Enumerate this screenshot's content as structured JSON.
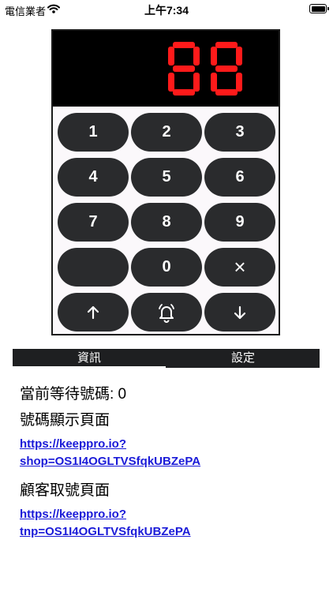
{
  "status_bar": {
    "carrier": "電信業者",
    "time": "上午7:34"
  },
  "display": {
    "number": "88",
    "digit_color": "#ff1a1a"
  },
  "keypad": {
    "keys": [
      "1",
      "2",
      "3",
      "4",
      "5",
      "6",
      "7",
      "8",
      "9",
      "",
      "0",
      "×"
    ],
    "nav": {
      "up_icon": "arrow-up-icon",
      "bell_icon": "bell-icon",
      "down_icon": "arrow-down-icon"
    }
  },
  "tabs": {
    "info": "資訊",
    "settings": "設定"
  },
  "info": {
    "waiting_label": "當前等待號碼: 0",
    "display_page_title": "號碼顯示頁面",
    "display_link_line1": "https://keeppro.io?",
    "display_link_line2": "shop=OS1I4OGLTVSfqkUBZePA",
    "customer_page_title": "顧客取號頁面",
    "customer_link_line1": "https://keeppro.io?",
    "customer_link_line2": "tnp=OS1I4OGLTVSfqkUBZePA"
  }
}
